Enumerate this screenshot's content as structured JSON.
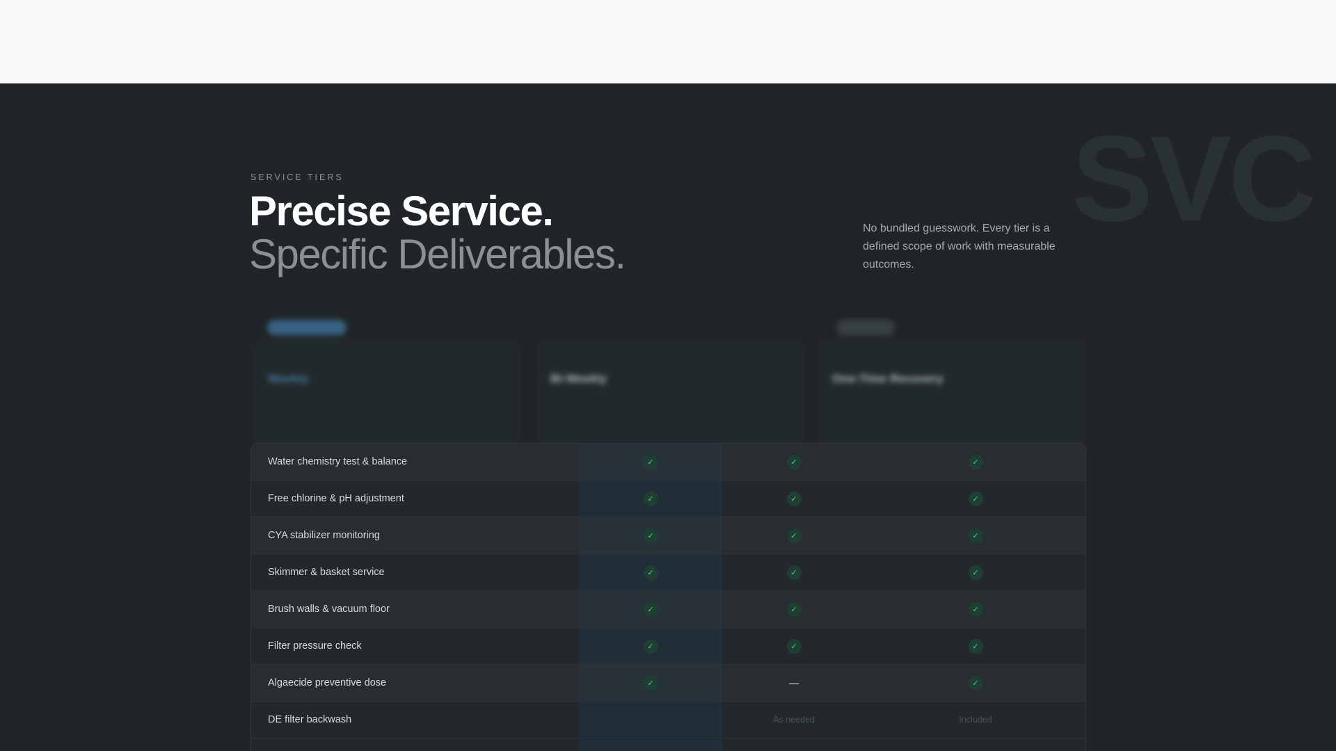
{
  "section": {
    "watermark": "SVC",
    "eyebrow": "SERVICE TIERS",
    "headline": "Precise Service.",
    "subheadline": "Specific Deliverables.",
    "intro": "No bundled guesswork. Every tier is a defined scope of work with measurable outcomes."
  },
  "cards": [
    {
      "pill": "",
      "title": "Weekly",
      "subtitle": "",
      "description": ""
    },
    {
      "title": "Bi-Weekly",
      "subtitle": "",
      "description": ""
    },
    {
      "pill": "",
      "title": "One-Time Recovery",
      "subtitle": "",
      "description": ""
    }
  ],
  "table": {
    "rows": [
      {
        "label": "Water chemistry test & balance",
        "cells": [
          "check",
          "check",
          "check"
        ]
      },
      {
        "label": "Free chlorine & pH adjustment",
        "cells": [
          "check",
          "check",
          "check"
        ]
      },
      {
        "label": "CYA stabilizer monitoring",
        "cells": [
          "check",
          "check",
          "check"
        ]
      },
      {
        "label": "Skimmer & basket service",
        "cells": [
          "check",
          "check",
          "check"
        ]
      },
      {
        "label": "Brush walls & vacuum floor",
        "cells": [
          "check",
          "check",
          "check"
        ]
      },
      {
        "label": "Filter pressure check",
        "cells": [
          "check",
          "check",
          "check"
        ]
      },
      {
        "label": "Algaecide preventive dose",
        "cells": [
          "check",
          "dash",
          "check"
        ]
      },
      {
        "label": "DE filter backwash",
        "cells": [
          "",
          "As needed",
          "Included"
        ]
      }
    ],
    "check_glyph": "✓",
    "dash_glyph": "—"
  },
  "colors": {
    "background": "#1f2528",
    "topbar": "#f8f9fb",
    "accent": "#4f89b6",
    "check": "#5fc896"
  }
}
